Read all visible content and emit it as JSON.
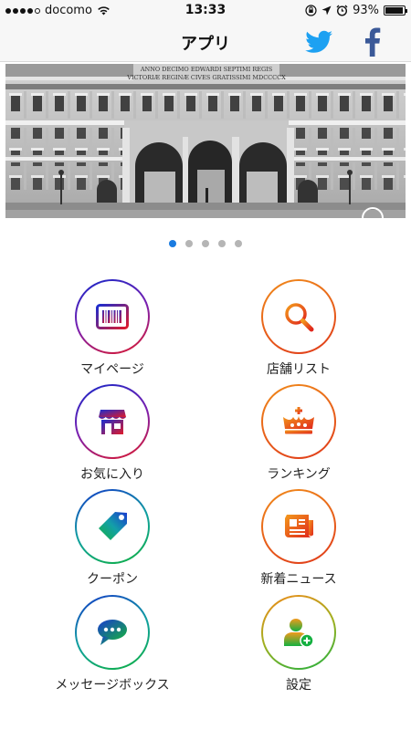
{
  "status_bar": {
    "carrier": "docomo",
    "time": "13:33",
    "battery": "93%",
    "battery_level": 0.93
  },
  "nav": {
    "title": "アプリ",
    "twitter_icon": "twitter-bird-icon",
    "facebook_icon": "facebook-f-icon",
    "twitter_color": "#1da1f2",
    "facebook_color": "#3b5998"
  },
  "banner": {
    "inscription_line1": "ANNO DECIMO EDWARDI SEPTIMI REGIS",
    "inscription_line2": "VICTORIÆ REGINÆ CIVES GRATISSIMI MDCCCCX",
    "slide_count": 5,
    "active_slide": 1
  },
  "menu": {
    "mypage": "マイページ",
    "stores": "店舗リスト",
    "favorites": "お気に入り",
    "ranking": "ランキング",
    "coupon": "クーポン",
    "news": "新着ニュース",
    "message_box": "メッセージボックス",
    "settings": "設定"
  },
  "colors": {
    "accent_blue": "#1a7be0",
    "gradient_red": "#e01a2a",
    "gradient_orange": "#f08a1a",
    "gradient_green": "#10b040"
  }
}
